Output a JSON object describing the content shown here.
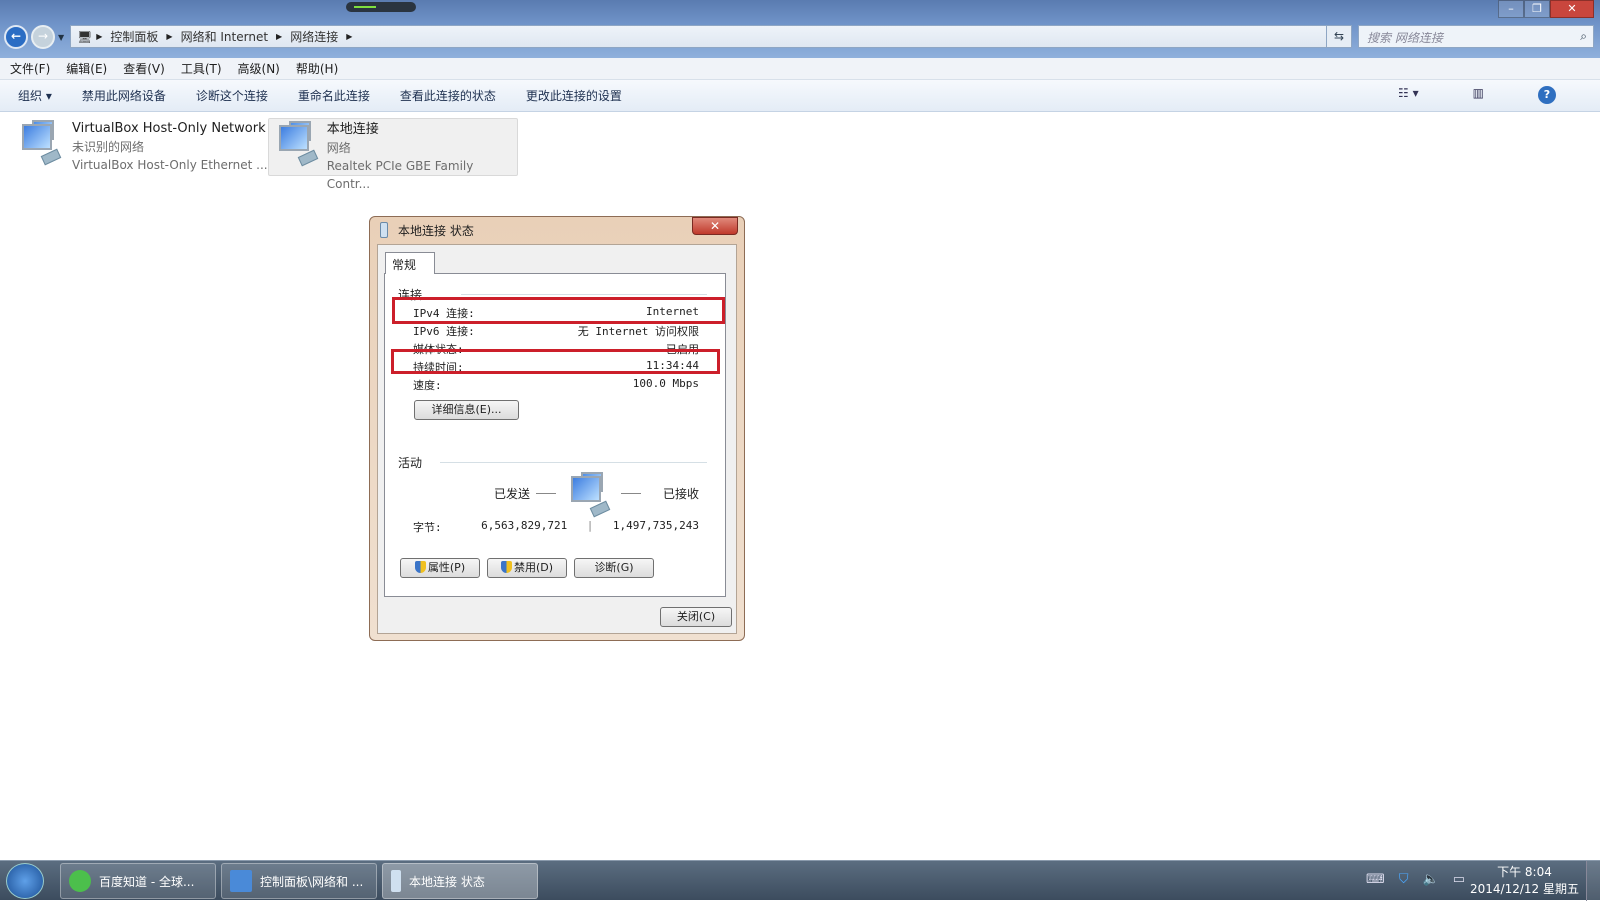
{
  "explorer": {
    "breadcrumb": [
      "控制面板",
      "网络和 Internet",
      "网络连接"
    ],
    "search_placeholder": "搜索 网络连接",
    "menu": [
      "文件(F)",
      "编辑(E)",
      "查看(V)",
      "工具(T)",
      "高级(N)",
      "帮助(H)"
    ],
    "commands": [
      "组织 ▾",
      "禁用此网络设备",
      "诊断这个连接",
      "重命名此连接",
      "查看此连接的状态",
      "更改此连接的设置"
    ],
    "adapters": [
      {
        "name": "VirtualBox Host-Only Network",
        "status": "未识别的网络",
        "device": "VirtualBox Host-Only Ethernet ..."
      },
      {
        "name": "本地连接",
        "status": "网络",
        "device": "Realtek PCIe GBE Family Contr...",
        "selected": true
      }
    ]
  },
  "dialog": {
    "title": "本地连接 状态",
    "tab": "常规",
    "connection_group": "连接",
    "rows": [
      {
        "label": "IPv4 连接:",
        "value": "Internet",
        "highlighted": true
      },
      {
        "label": "IPv6 连接:",
        "value": "无 Internet 访问权限"
      },
      {
        "label": "媒体状态:",
        "value": "已启用"
      },
      {
        "label": "持续时间:",
        "value": "11:34:44",
        "highlighted": true
      },
      {
        "label": "速度:",
        "value": "100.0 Mbps"
      }
    ],
    "details_button": "详细信息(E)...",
    "activity_group": "活动",
    "sent_label": "已发送",
    "received_label": "已接收",
    "bytes_label": "字节:",
    "bytes_sent": "6,563,829,721",
    "bytes_received": "1,497,735,243",
    "properties_button": "属性(P)",
    "disable_button": "禁用(D)",
    "diagnose_button": "诊断(G)",
    "close_button": "关闭(C)",
    "highlight_color": "#cc1f2a"
  },
  "taskbar": {
    "items": [
      "百度知道 - 全球...",
      "控制面板\\网络和 ...",
      "本地连接 状态"
    ],
    "time": "下午 8:04",
    "date": "2014/12/12 星期五"
  }
}
